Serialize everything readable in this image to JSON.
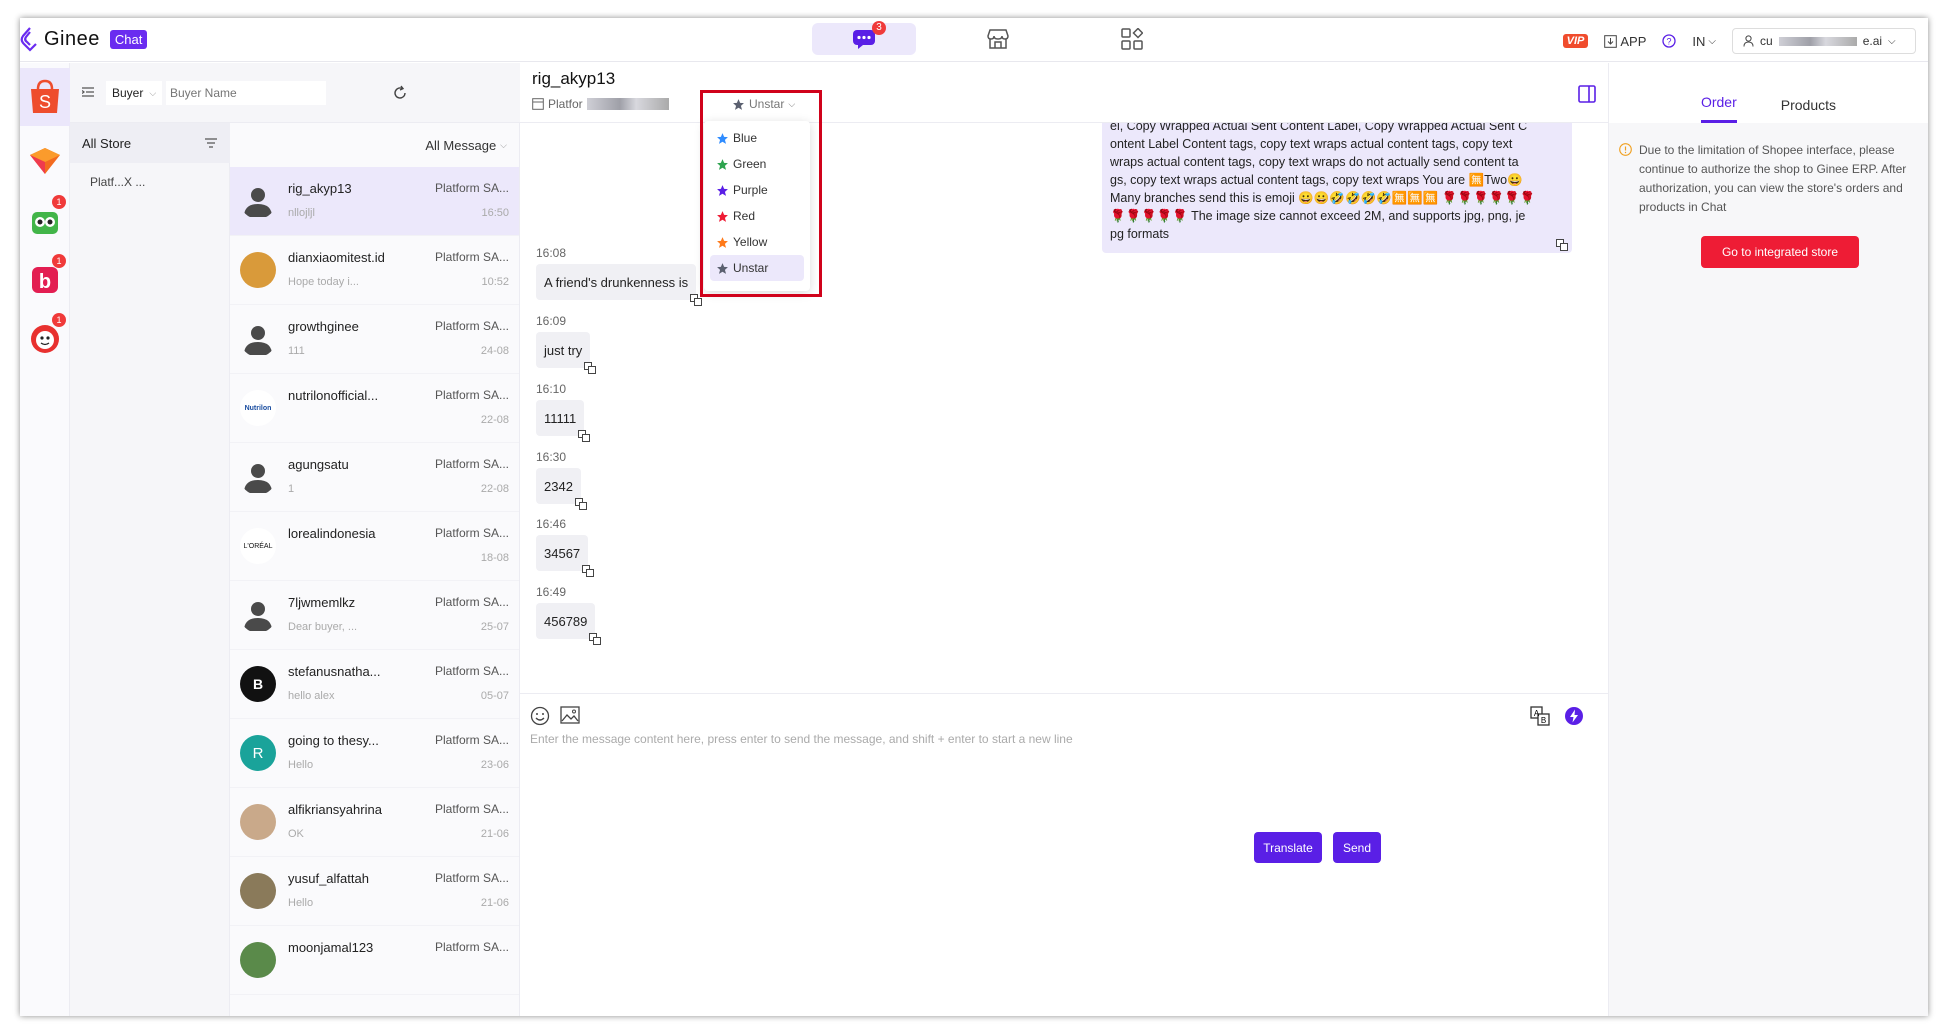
{
  "app": {
    "brand": "Ginee",
    "product_chip": "Chat"
  },
  "topnav": {
    "chat_badge": "3"
  },
  "topbar": {
    "vip": "VIP",
    "app_label": "APP",
    "region": "IN",
    "user_prefix": "cu",
    "user_suffix": "e.ai"
  },
  "rail": {
    "badges": [
      "1",
      "1",
      "1"
    ]
  },
  "filter": {
    "type": "Buyer",
    "placeholder": "Buyer Name"
  },
  "stores": {
    "header": "All Store",
    "item": "Platf...X ..."
  },
  "conversations": {
    "filter_label": "All Message",
    "items": [
      {
        "name": "rig_akyp13",
        "store": "Platform SA...",
        "preview": "nllojljl",
        "time": "16:50",
        "avatar": "default"
      },
      {
        "name": "dianxiaomitest.id",
        "store": "Platform SA...",
        "preview": "Hope today i...",
        "time": "10:52",
        "avatar": "bear"
      },
      {
        "name": "growthginee",
        "store": "Platform SA...",
        "preview": "111",
        "time": "24-08",
        "avatar": "default"
      },
      {
        "name": "nutrilonofficial...",
        "store": "Platform SA...",
        "preview": "",
        "time": "22-08",
        "avatar": "nutrilon"
      },
      {
        "name": "agungsatu",
        "store": "Platform SA...",
        "preview": "1",
        "time": "22-08",
        "avatar": "default"
      },
      {
        "name": "lorealindonesia",
        "store": "Platform SA...",
        "preview": "",
        "time": "18-08",
        "avatar": "loreal"
      },
      {
        "name": "7ljwmemlkz",
        "store": "Platform SA...",
        "preview": "Dear buyer, ...",
        "time": "25-07",
        "avatar": "default"
      },
      {
        "name": "stefanusnatha...",
        "store": "Platform SA...",
        "preview": "hello alex",
        "time": "05-07",
        "avatar": "black"
      },
      {
        "name": "going to thesy...",
        "store": "Platform SA...",
        "preview": "Hello",
        "time": "23-06",
        "avatar": "R"
      },
      {
        "name": "alfikriansyahrina",
        "store": "Platform SA...",
        "preview": "OK",
        "time": "21-06",
        "avatar": "photo1"
      },
      {
        "name": "yusuf_alfattah",
        "store": "Platform SA...",
        "preview": "Hello",
        "time": "21-06",
        "avatar": "photo2"
      },
      {
        "name": "moonjamal123",
        "store": "Platform SA...",
        "preview": "",
        "time": "",
        "avatar": "photo3"
      }
    ]
  },
  "chat": {
    "title": "rig_akyp13",
    "platform": "Platfor",
    "star_label": "Unstar",
    "star_options": [
      {
        "label": "Blue",
        "color": "#2f8cff"
      },
      {
        "label": "Green",
        "color": "#2ea44f"
      },
      {
        "label": "Purple",
        "color": "#5a1fe6"
      },
      {
        "label": "Red",
        "color": "#ee1c35"
      },
      {
        "label": "Yellow",
        "color": "#ff7a1a"
      },
      {
        "label": "Unstar",
        "color": "#5b6070"
      }
    ],
    "outgoing": [
      "el, Copy Wrapped Actual Sent Content Label, Copy Wrapped Actual Sent C",
      "ontent Label Content tags, copy text wraps actual content tags, copy text",
      "wraps actual content tags, copy text wraps do not actually send content ta",
      "gs, copy text wraps actual content tags, copy text wraps You are 🈚Two😀",
      "Many branches send this is emoji 😀😀🤣🤣🤣🤣🈚🈚🈚 🌹🌹🌹🌹🌹🌹",
      "🌹🌹🌹🌹🌹 The image size cannot exceed 2M, and supports jpg, png, je",
      "pg formats"
    ],
    "messages": [
      {
        "time": "16:08",
        "text": "A friend's drunkenness is"
      },
      {
        "time": "16:09",
        "text": "just try"
      },
      {
        "time": "16:10",
        "text": "11111"
      },
      {
        "time": "16:30",
        "text": "2342"
      },
      {
        "time": "16:46",
        "text": "34567"
      },
      {
        "time": "16:49",
        "text": "456789"
      }
    ]
  },
  "composer": {
    "placeholder": "Enter the message content here, press enter to send the message, and shift + enter to start a new line",
    "translate": "Translate",
    "send": "Send"
  },
  "right_panel": {
    "tabs": [
      "Order",
      "Products"
    ],
    "notice": "Due to the limitation of Shopee interface, please continue to authorize the shop to Ginee ERP. After authorization, you can view the store's orders and products in Chat",
    "go_button": "Go to integrated store"
  }
}
